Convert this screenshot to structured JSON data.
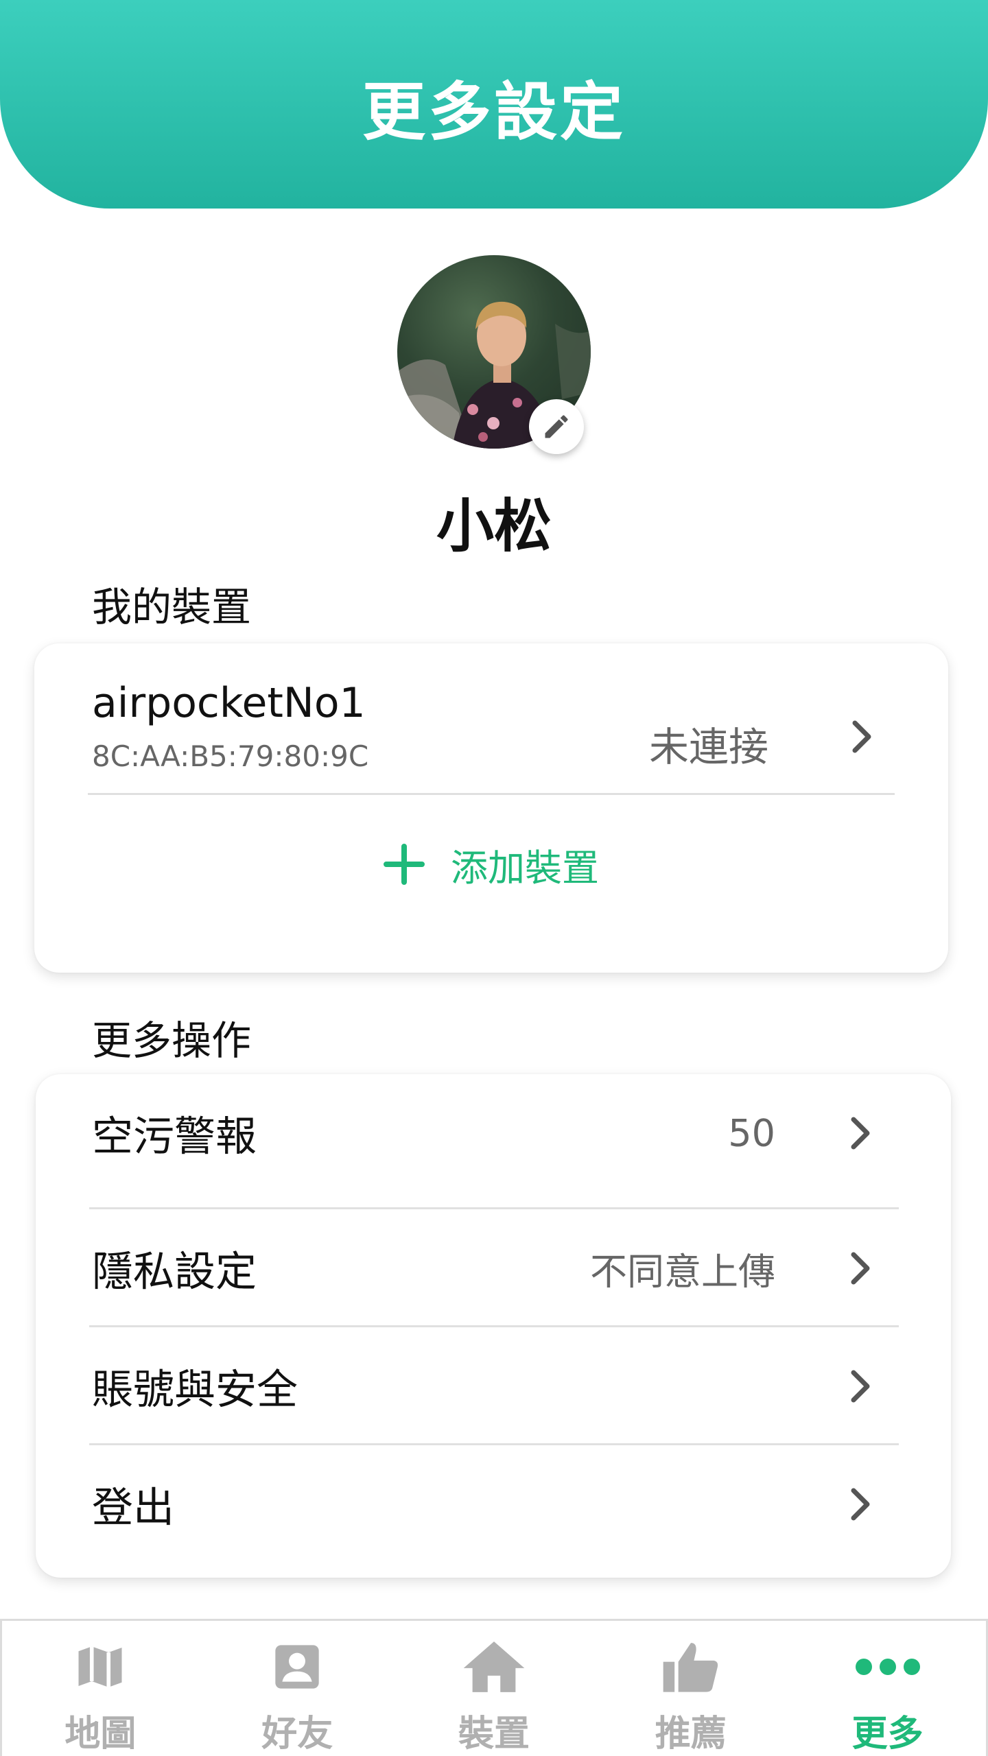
{
  "header": {
    "title": "更多設定"
  },
  "profile": {
    "name": "小松"
  },
  "devices_section": {
    "label": "我的裝置"
  },
  "device": {
    "name": "airpocketNo1",
    "mac": "8C:AA:B5:79:80:9C",
    "status": "未連接"
  },
  "add_device": {
    "label": "添加裝置"
  },
  "more_section": {
    "label": "更多操作"
  },
  "operations": [
    {
      "label": "空污警報",
      "value": "50"
    },
    {
      "label": "隱私設定",
      "value": "不同意上傳"
    },
    {
      "label": "賬號與安全",
      "value": ""
    },
    {
      "label": "登出",
      "value": ""
    }
  ],
  "nav": [
    {
      "label": "地圖",
      "icon": "map-icon"
    },
    {
      "label": "好友",
      "icon": "contact-icon"
    },
    {
      "label": "裝置",
      "icon": "home-icon"
    },
    {
      "label": "推薦",
      "icon": "thumbs-up-icon"
    },
    {
      "label": "更多",
      "icon": "more-dots-icon"
    }
  ],
  "colors": {
    "header": "#2cc0ac",
    "accent": "#1fb97a",
    "nav_inactive": "#b0b0b0"
  }
}
